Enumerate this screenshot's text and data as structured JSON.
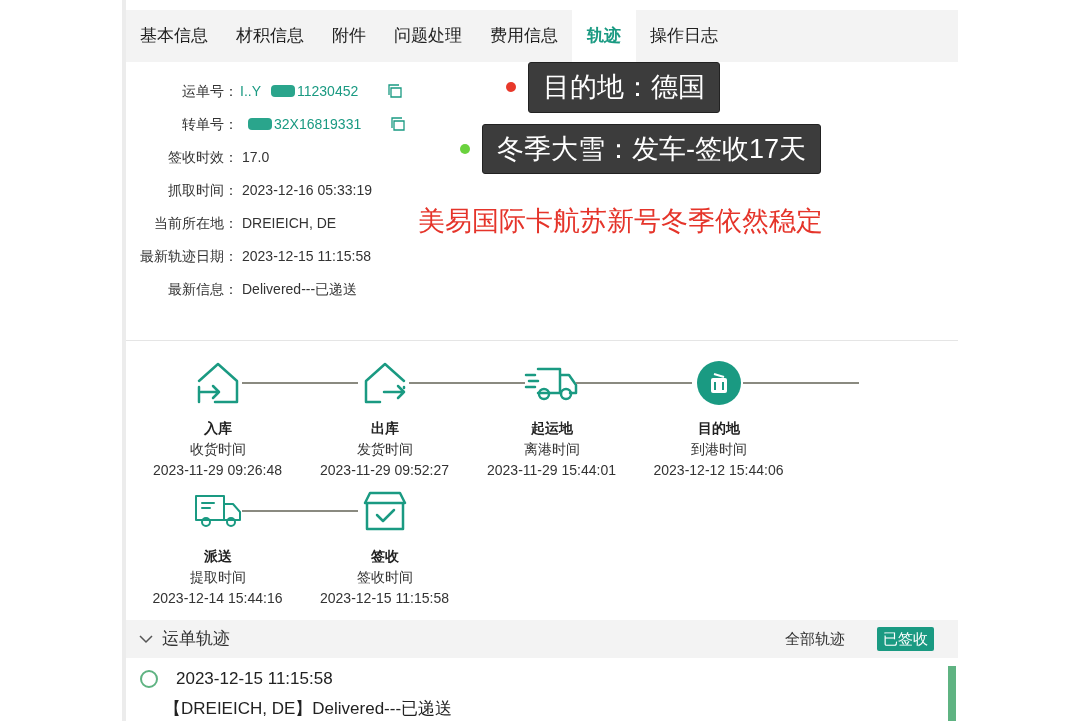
{
  "tabs": [
    {
      "label": "基本信息",
      "selected": false
    },
    {
      "label": "材积信息",
      "selected": false
    },
    {
      "label": "附件",
      "selected": false
    },
    {
      "label": "问题处理",
      "selected": false
    },
    {
      "label": "费用信息",
      "selected": false
    },
    {
      "label": "轨迹",
      "selected": true
    },
    {
      "label": "操作日志",
      "selected": false
    }
  ],
  "info": [
    {
      "label": "运单号：",
      "value": "I..Y",
      "value_tail": "11230452",
      "kind": "redacted-copy"
    },
    {
      "label": "转单号：",
      "value_tail": "32X16819331",
      "kind": "redacted-copy"
    },
    {
      "label": "签收时效：",
      "value": "17.0",
      "kind": "plain"
    },
    {
      "label": "抓取时间：",
      "value": "2023-12-16 05:33:19",
      "kind": "plain"
    },
    {
      "label": "当前所在地：",
      "value": "DREIEICH, DE",
      "kind": "plain"
    },
    {
      "label": "最新轨迹日期：",
      "value": "2023-12-15 11:15:58",
      "kind": "plain"
    },
    {
      "label": "最新信息：",
      "value": "Delivered---已递送",
      "kind": "plain"
    }
  ],
  "callouts": [
    {
      "text": "目的地：德国",
      "color": "#e8382a"
    },
    {
      "text": "冬季大雪：发车-签收17天",
      "color": "#6ad23e"
    }
  ],
  "headline": "美易国际卡航苏新号冬季依然稳定",
  "timeline": [
    {
      "tail_line": true,
      "steps": [
        {
          "kind": "inbound",
          "title": "入库",
          "subtitle": "收货时间",
          "time": "2023-11-29 09:26:48",
          "highlighted": false
        },
        {
          "kind": "outbound",
          "title": "出库",
          "subtitle": "发货时间",
          "time": "2023-11-29 09:52:27",
          "highlighted": false
        },
        {
          "kind": "truck",
          "title": "起运地",
          "subtitle": "离港时间",
          "time": "2023-11-29 15:44:01",
          "highlighted": false
        },
        {
          "kind": "arrival",
          "title": "目的地",
          "subtitle": "到港时间",
          "time": "2023-12-12 15:44:06",
          "highlighted": true
        }
      ]
    },
    {
      "tail_line": false,
      "steps": [
        {
          "kind": "delivery",
          "title": "派送",
          "subtitle": "提取时间",
          "time": "2023-12-14 15:44:16",
          "highlighted": false
        },
        {
          "kind": "signed",
          "title": "签收",
          "subtitle": "签收时间",
          "time": "2023-12-15 11:15:58",
          "highlighted": false
        }
      ]
    }
  ],
  "tracking": {
    "title": "运单轨迹",
    "expanded": true,
    "all_link": "全部轨迹",
    "status": "已签收",
    "events": [
      {
        "time": "2023-12-15 11:15:58",
        "text": "【DREIEICH, DE】Delivered---已递送"
      }
    ]
  }
}
